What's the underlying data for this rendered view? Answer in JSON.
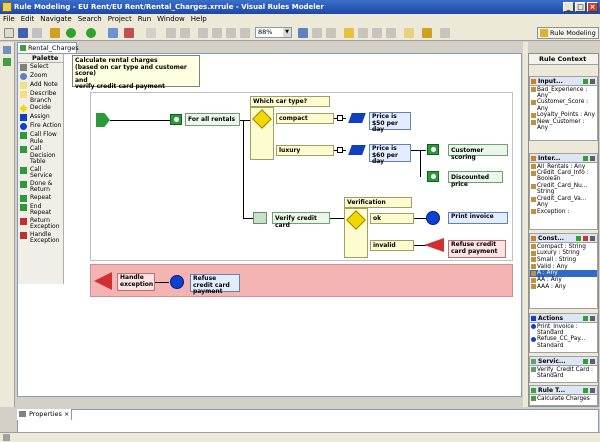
{
  "window": {
    "title": "Rule Modeling - EU Rent/EU Rent/Rental_Charges.xrrule - Visual Rules Modeler",
    "controls": {
      "minimize": "_",
      "maximize": "□",
      "close": "×"
    }
  },
  "menu": [
    "File",
    "Edit",
    "Navigate",
    "Search",
    "Project",
    "Run",
    "Window",
    "Help"
  ],
  "toolbar": {
    "zoom": "88%",
    "perspective": "Rule Modeling"
  },
  "editor": {
    "tab": "Rental_Charges"
  },
  "palette": {
    "title": "Palette",
    "items": [
      {
        "label": "Select",
        "icon": "arrow-select-icon"
      },
      {
        "label": "Zoom",
        "icon": "zoom-icon"
      },
      {
        "label": "Add Note",
        "icon": "note-icon"
      },
      {
        "label": "Describe Branch",
        "icon": "branch-icon"
      },
      {
        "label": "Decide",
        "icon": "diamond-icon"
      },
      {
        "label": "Assign",
        "icon": "assign-icon"
      },
      {
        "label": "Fire Action",
        "icon": "circle-icon"
      },
      {
        "label": "Call Flow Rule",
        "icon": "flow-icon"
      },
      {
        "label": "Call Decision Table",
        "icon": "table-icon"
      },
      {
        "label": "Call Service",
        "icon": "service-icon"
      },
      {
        "label": "Done & Return",
        "icon": "done-icon"
      },
      {
        "label": "Repeat",
        "icon": "repeat-icon"
      },
      {
        "label": "End Repeat",
        "icon": "end-repeat-icon"
      },
      {
        "label": "Return Exception",
        "icon": "return-exception-icon"
      },
      {
        "label": "Handle Exception",
        "icon": "handle-exception-icon"
      }
    ]
  },
  "tooltip": {
    "lines": [
      "Calculate rental charges",
      "(based on car type and customer score)",
      "and",
      "verify credit card payment"
    ]
  },
  "diagram": {
    "for_all_rentals": "For all rentals",
    "which_car_type": "Which car type?",
    "compact": "compact",
    "luxury": "luxury",
    "price_compact": "Price is $50 per day",
    "price_luxury": "Price is $60 per day",
    "customer_scoring": "Customer scoring",
    "discounted_price": "Discounted price",
    "verify_credit_card": "Verify credit card",
    "verification": "Verification",
    "ok": "ok",
    "invalid": "invalid",
    "print_invoice": "Print invoice",
    "refuse_payment": "Refuse credit card payment",
    "handle_exception": "Handle exception",
    "refuse_payment_2": "Refuse credit card payment"
  },
  "rule_context": {
    "title": "Rule Context",
    "sections": [
      {
        "title": "Input...",
        "items": [
          "Bad_Experience : Any",
          "Customer_Score : Any",
          "Loyalty_Points : Any",
          "New_Customer : Any"
        ]
      },
      {
        "title": "Inter...",
        "items": [
          "All_Rentals : Any",
          "Credit_Card_Info : Boolean",
          "Credit_Card_Nu... String",
          "Credit_Card_Va... Any",
          "Exception :"
        ]
      },
      {
        "title": "Const...",
        "items": [
          "Compact : String",
          "Luxury : String",
          "Small : String",
          "Valid : Any",
          "A : Any",
          "AA : Any",
          "AAA : Any"
        ]
      },
      {
        "title": "Actions",
        "items": [
          "Print_Invoice : Standard",
          "Refuse_CC_Pay... Standard"
        ]
      },
      {
        "title": "Servic...",
        "items": [
          "Verify_Credit Card : Standard"
        ]
      },
      {
        "title": "Rule T...",
        "items": [
          "Calculate Charges"
        ]
      }
    ]
  },
  "properties": {
    "tab": "Properties"
  },
  "colors": {
    "titlebar": "#1c47a8",
    "lane_exception": "#f4b4b4",
    "selected": "#316ac5"
  }
}
